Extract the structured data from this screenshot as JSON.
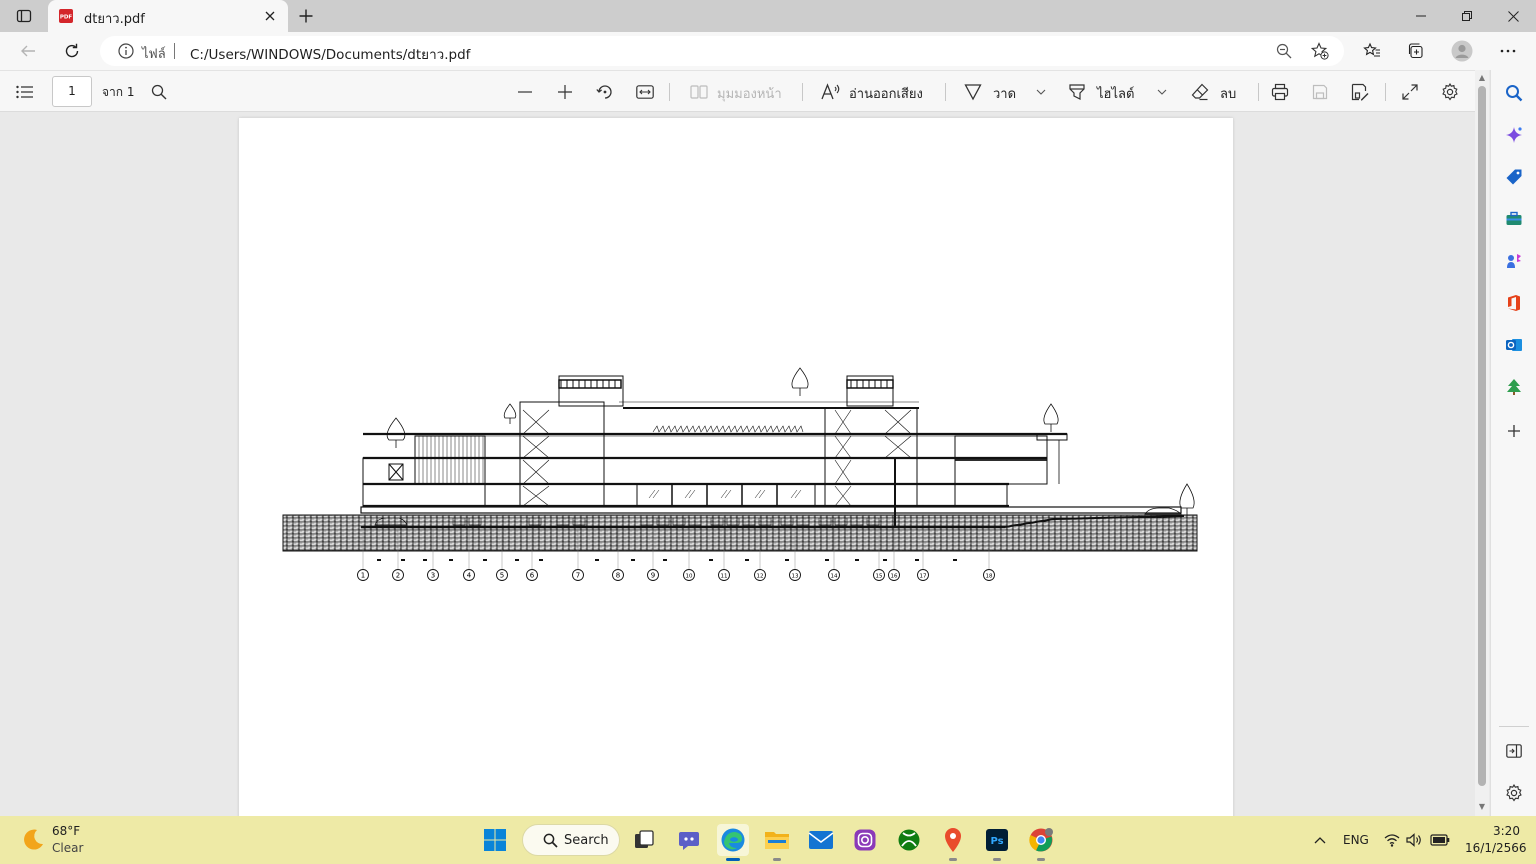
{
  "tab": {
    "title": "dtยาว.pdf",
    "favicon_text": "PDF"
  },
  "address": {
    "label": "ไฟล์",
    "url": "C:/Users/WINDOWS/Documents/dtยาว.pdf"
  },
  "pdf_toolbar": {
    "page_number": "1",
    "page_of": "จาก 1",
    "page_view": "มุมมองหน้า",
    "read_aloud": "อ่านออกเสียง",
    "draw": "วาด",
    "highlight": "ไฮไลต์",
    "erase": "ลบ"
  },
  "drawing": {
    "gridlines": [
      "1",
      "2",
      "3",
      "4",
      "5",
      "6",
      "7",
      "8",
      "9",
      "10",
      "11",
      "12",
      "13",
      "14",
      "15",
      "16",
      "17",
      "18"
    ]
  },
  "taskbar": {
    "weather": {
      "temp": "68°F",
      "condition": "Clear"
    },
    "search_label": "Search",
    "apps": [
      "start",
      "search",
      "task-view",
      "chat",
      "edge",
      "file-explorer",
      "mail",
      "instagram",
      "xbox",
      "maps",
      "photoshop",
      "chrome"
    ],
    "active_app": "edge",
    "language": "ENG",
    "time": "3:20",
    "date": "16/1/2566"
  },
  "colors": {
    "taskbar": "#eeeaa6",
    "accent": "#005fb8",
    "pdf_red": "#d4262b"
  }
}
